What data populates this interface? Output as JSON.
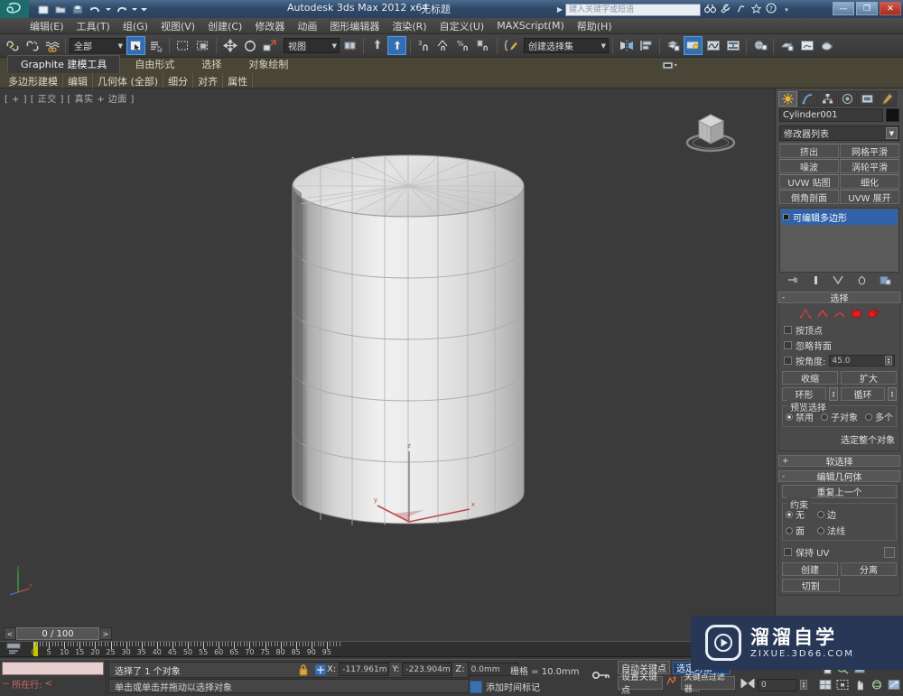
{
  "titlebar": {
    "app_title": "Autodesk 3ds Max  2012 x64",
    "document": "无标题",
    "search_placeholder": "键入关键字或短语",
    "quick_access": [
      {
        "name": "new-file-icon",
        "glyph": "▤"
      },
      {
        "name": "open-file-icon",
        "glyph": "▭"
      },
      {
        "name": "save-file-icon",
        "glyph": "▣"
      },
      {
        "name": "undo-icon",
        "glyph": "↶"
      },
      {
        "name": "undo-dropdown-icon",
        "glyph": "▾"
      },
      {
        "name": "redo-icon",
        "glyph": "↷"
      },
      {
        "name": "redo-dropdown-icon",
        "glyph": "▾"
      },
      {
        "name": "qat-customize-icon",
        "glyph": "▾"
      }
    ],
    "help_icons": [
      {
        "name": "binoculars-icon",
        "glyph": "👓"
      },
      {
        "name": "wrench-icon",
        "glyph": "🔧"
      },
      {
        "name": "feedback-icon",
        "glyph": "⌁"
      },
      {
        "name": "favorite-star-icon",
        "glyph": "☆"
      },
      {
        "name": "help-circle-icon",
        "glyph": "?"
      }
    ],
    "window_buttons": [
      {
        "name": "minimize-button",
        "glyph": "—"
      },
      {
        "name": "maximize-button",
        "glyph": "▭"
      },
      {
        "name": "close-button",
        "glyph": "✕"
      }
    ]
  },
  "menubar": {
    "items": [
      {
        "label": "编辑(E)"
      },
      {
        "label": "工具(T)"
      },
      {
        "label": "组(G)"
      },
      {
        "label": "视图(V)"
      },
      {
        "label": "创建(C)"
      },
      {
        "label": "修改器"
      },
      {
        "label": "动画"
      },
      {
        "label": "图形编辑器"
      },
      {
        "label": "渲染(R)"
      },
      {
        "label": "自定义(U)"
      },
      {
        "label": "MAXScript(M)"
      },
      {
        "label": "帮助(H)"
      }
    ]
  },
  "toolbar": {
    "selection_filter": "全部",
    "reference_coord": "视图",
    "named_selection_set": "创建选择集",
    "buttons": [
      {
        "name": "select-link-icon",
        "glyph": "🔗"
      },
      {
        "name": "unlink-selection-icon",
        "glyph": "⛓"
      },
      {
        "name": "bind-to-space-warp-icon",
        "glyph": "≈"
      },
      {
        "name": "select-object-icon",
        "glyph": "⬉",
        "active": true
      },
      {
        "name": "select-by-name-icon",
        "glyph": "☰"
      },
      {
        "name": "rectangular-selection-region-icon",
        "glyph": "▢"
      },
      {
        "name": "window-crossing-icon",
        "glyph": "▣"
      },
      {
        "name": "select-and-move-icon",
        "glyph": "✥"
      },
      {
        "name": "select-and-rotate-icon",
        "glyph": "↻"
      },
      {
        "name": "select-and-scale-icon",
        "glyph": "⬘"
      },
      {
        "name": "use-center-flyout-icon",
        "glyph": "⊕"
      },
      {
        "name": "select-and-manipulate-icon",
        "glyph": "⬆",
        "active": true
      },
      {
        "name": "snap-toggle-icon",
        "glyph": "3"
      },
      {
        "name": "angle-snap-toggle-icon",
        "glyph": "∠"
      },
      {
        "name": "percent-snap-toggle-icon",
        "glyph": "%"
      },
      {
        "name": "spinner-snap-toggle-icon",
        "glyph": "⇕"
      },
      {
        "name": "edit-named-selection-icon",
        "glyph": "✎"
      },
      {
        "name": "mirror-icon",
        "glyph": "⊪"
      },
      {
        "name": "align-icon",
        "glyph": "⊨"
      },
      {
        "name": "layer-manager-icon",
        "glyph": "▤"
      },
      {
        "name": "graphite-modeling-toggle-icon",
        "glyph": "▥",
        "active": true
      },
      {
        "name": "curve-editor-icon",
        "glyph": "∿"
      },
      {
        "name": "schematic-view-icon",
        "glyph": "⧉"
      },
      {
        "name": "material-editor-icon",
        "glyph": "◍"
      },
      {
        "name": "render-setup-icon",
        "glyph": "☗"
      },
      {
        "name": "rendered-frame-window-icon",
        "glyph": "⬚"
      },
      {
        "name": "render-production-icon",
        "glyph": "🫖"
      }
    ]
  },
  "ribbon": {
    "tabs": [
      {
        "label": "Graphite 建模工具",
        "active": true
      },
      {
        "label": "自由形式",
        "active": false
      },
      {
        "label": "选择",
        "active": false
      },
      {
        "label": "对象绘制",
        "active": false
      }
    ],
    "subtabs": [
      {
        "label": "多边形建模"
      },
      {
        "label": "编辑"
      },
      {
        "label": "几何体 (全部)"
      },
      {
        "label": "细分"
      },
      {
        "label": "对齐"
      },
      {
        "label": "属性"
      }
    ]
  },
  "viewport": {
    "label": "[ + ] [ 正交 ] [ 真实 + 边面 ]",
    "viewcube_name": "view-cube",
    "axis_x": "x",
    "axis_y": "y",
    "axis_z": "z",
    "origin_axis_z": "z",
    "origin_axis_x": "x"
  },
  "command_panel": {
    "tabs": [
      {
        "name": "create-tab",
        "glyph": "✸",
        "active": true
      },
      {
        "name": "modify-tab",
        "glyph": "⌒",
        "active": false
      },
      {
        "name": "hierarchy-tab",
        "glyph": "⚖",
        "active": false
      },
      {
        "name": "motion-tab",
        "glyph": "◎",
        "active": false
      },
      {
        "name": "display-tab",
        "glyph": "▣",
        "active": false
      },
      {
        "name": "utilities-tab",
        "glyph": "🔨",
        "active": false
      }
    ],
    "object_name": "Cylinder001",
    "modifier_list_label": "修改器列表",
    "modifier_buttons": [
      {
        "label": "挤出"
      },
      {
        "label": "网格平滑"
      },
      {
        "label": "噪波"
      },
      {
        "label": "涡轮平滑"
      },
      {
        "label": "UVW 贴图"
      },
      {
        "label": "细化"
      },
      {
        "label": "倒角剖面"
      },
      {
        "label": "UVW 展开"
      }
    ],
    "modifier_stack": [
      {
        "label": "可编辑多边形",
        "selected": true
      }
    ],
    "stack_tools": [
      {
        "name": "pin-stack-icon",
        "glyph": "⇥"
      },
      {
        "name": "show-end-result-icon",
        "glyph": "▮"
      },
      {
        "name": "make-unique-icon",
        "glyph": "⋎"
      },
      {
        "name": "remove-modifier-icon",
        "glyph": "⎋"
      },
      {
        "name": "configure-modifier-sets-icon",
        "glyph": "▤"
      }
    ],
    "selection_rollout": {
      "title": "选择",
      "subobject_icons": [
        {
          "name": "vertex-subobject-icon",
          "glyph": "⋰"
        },
        {
          "name": "edge-subobject-icon",
          "glyph": "╱"
        },
        {
          "name": "border-subobject-icon",
          "glyph": "◠"
        },
        {
          "name": "polygon-subobject-icon",
          "glyph": "■"
        },
        {
          "name": "element-subobject-icon",
          "glyph": "◧"
        }
      ],
      "by_vertex": "按顶点",
      "ignore_backfacing": "忽略背面",
      "by_angle": "按角度:",
      "by_angle_value": "45.0",
      "shrink": "收缩",
      "grow": "扩大",
      "ring": "环形",
      "loop": "循环",
      "preview_selection_title": "预览选择",
      "preview_options": [
        {
          "label": "禁用",
          "selected": true
        },
        {
          "label": "子对象",
          "selected": false
        },
        {
          "label": "多个",
          "selected": false
        }
      ],
      "status_text": "选定整个对象"
    },
    "soft_selection_title": "软选择",
    "edit_geometry": {
      "title": "编辑几何体",
      "repeat_last": "重复上一个",
      "constraints_title": "约束",
      "constraints": [
        {
          "label": "无",
          "selected": true
        },
        {
          "label": "边",
          "selected": false
        },
        {
          "label": "面",
          "selected": false
        },
        {
          "label": "法线",
          "selected": false
        }
      ],
      "preserve_uv": "保持 UV",
      "create": "创建",
      "detach": "分离",
      "cut": "切割"
    }
  },
  "timeline": {
    "frame_indicator": "0 / 100",
    "prev_frame_glyph": "<",
    "next_frame_glyph": ">",
    "tick_labels": [
      "0",
      "5",
      "10",
      "15",
      "20",
      "25",
      "30",
      "35",
      "40",
      "45",
      "50",
      "55",
      "60",
      "65",
      "70",
      "75",
      "80",
      "85",
      "90",
      "95"
    ],
    "current_frame": 0,
    "range_end": 100
  },
  "statusbar": {
    "mr_row_label": "所在行:",
    "mr_prefix": "--",
    "mr_suffix": "<",
    "selection_text": "选择了 1 个对象",
    "prompt_text": "单击或单击并拖动以选择对象",
    "lock_icon": "lock-selection-icon",
    "absrel_icon": "absolute-relative-toggle-icon",
    "coords": [
      {
        "label": "X:",
        "value": "-117.961m"
      },
      {
        "label": "Y:",
        "value": "-223.904m"
      },
      {
        "label": "Z:",
        "value": "0.0mm"
      }
    ],
    "grid_text": "栅格 = 10.0mm",
    "add_time_tag": "添加时间标记",
    "auto_key": "自动关键点",
    "selected_object_field": "选定对象",
    "set_key": "设置关键点",
    "key_filters": "关键点过滤器...",
    "key_mode_frame": "0",
    "nav_icons_row1": [
      {
        "name": "zoom-extents-all-icon",
        "glyph": "⧉"
      },
      {
        "name": "zoom-region-icon",
        "glyph": "⬚"
      },
      {
        "name": "field-of-view-icon",
        "glyph": "◔"
      }
    ],
    "nav_icons_row2": [
      {
        "name": "zoom-all-icon",
        "glyph": "⊞"
      },
      {
        "name": "zoom-extents-selected-icon",
        "glyph": "⬚"
      },
      {
        "name": "pan-view-icon",
        "glyph": "✋"
      },
      {
        "name": "orbit-icon",
        "glyph": "◐"
      },
      {
        "name": "maximize-viewport-icon",
        "glyph": "⬓"
      }
    ],
    "key_toggle_icon": "key-mode-toggle-icon",
    "play_icon": "play-animation-icon"
  },
  "watermark": {
    "cn_text": "溜溜自学",
    "en_text": "ZIXUE.3D66.COM",
    "logo_name": "play-button-logo"
  },
  "colors": {
    "accent_blue": "#2f6fb8",
    "ribbon_olive": "#4a4637",
    "panel_gray": "#4a4a4a",
    "watermark_navy": "#293757",
    "axis_red": "#c04a4a"
  }
}
